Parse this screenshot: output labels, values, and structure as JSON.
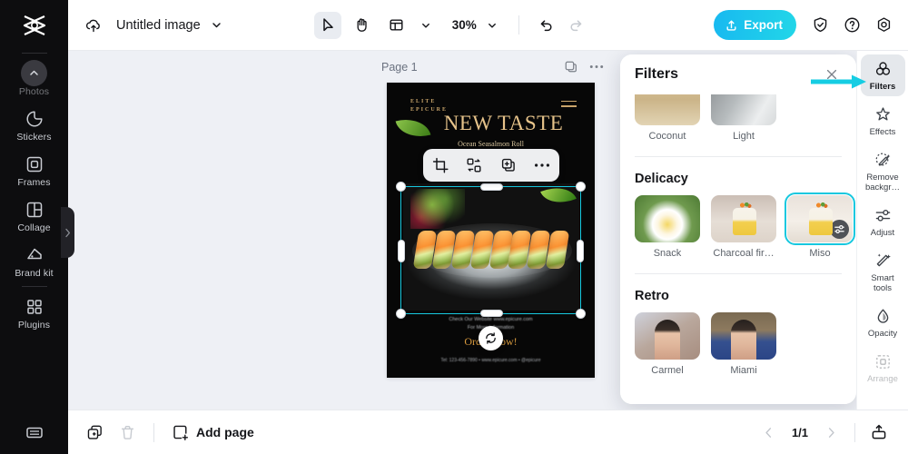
{
  "app": {
    "title": "Untitled image",
    "zoom": "30%",
    "export_label": "Export"
  },
  "topbar": {
    "cloud_icon": "cloud-upload-icon",
    "title_caret_icon": "chevron-down-icon",
    "select_tool_icon": "cursor-arrow-icon",
    "hand_tool_icon": "hand-icon",
    "layout_icon": "layout-icon",
    "layout_caret_icon": "chevron-down-icon",
    "zoom_caret_icon": "chevron-down-icon",
    "undo_icon": "undo-icon",
    "redo_icon": "redo-icon",
    "upload_icon": "upload-icon",
    "shield_icon": "shield-check-icon",
    "help_icon": "question-circle-icon",
    "settings_icon": "settings-gear-icon"
  },
  "left_rail": {
    "logo_icon": "capcut-logo-icon",
    "collapse_icon": "chevron-up-icon",
    "tab_icon": "chevron-right-icon",
    "items": [
      {
        "label": "Photos",
        "icon": "photos-icon"
      },
      {
        "label": "Stickers",
        "icon": "sticker-icon"
      },
      {
        "label": "Frames",
        "icon": "frame-icon"
      },
      {
        "label": "Collage",
        "icon": "collage-icon"
      },
      {
        "label": "Brand kit",
        "icon": "brand-kit-icon"
      },
      {
        "label": "Plugins",
        "icon": "plugins-grid-icon"
      }
    ],
    "bottom_icon": "keyboard-icon"
  },
  "canvas": {
    "page_label": "Page 1",
    "page_icons": [
      "duplicate-page-icon",
      "more-options-icon"
    ],
    "float_toolbar": {
      "crop_icon": "crop-icon",
      "replace_icon": "replace-image-icon",
      "duplicate_icon": "duplicate-icon",
      "more_icon": "more-options-icon"
    },
    "rotate_icon": "rotate-icon",
    "poster": {
      "brand_line1": "ELITE",
      "brand_line2": "EPICURE",
      "title": "NEW TASTE",
      "subtitle": "Ocean Seasalmon Roll",
      "info_line1": "Check Our Website www.epicure.com",
      "info_line2": "For More Information",
      "cta": "Order Now!",
      "footer": "Tel: 123-456-7890 • www.epicure.com • @epicure"
    }
  },
  "filters_panel": {
    "title": "Filters",
    "close_icon": "close-icon",
    "sections": [
      {
        "name": "",
        "items": [
          {
            "label": "Coconut",
            "art": "t-coconut",
            "selected": false
          },
          {
            "label": "Light",
            "art": "t-light",
            "selected": false
          }
        ]
      },
      {
        "name": "Delicacy",
        "items": [
          {
            "label": "Snack",
            "art": "t-snack",
            "selected": false
          },
          {
            "label": "Charcoal fir…",
            "art": "t-charcoal cake",
            "selected": false
          },
          {
            "label": "Miso",
            "art": "t-miso cake",
            "selected": true,
            "badge_icon": "adjust-sliders-icon"
          }
        ]
      },
      {
        "name": "Retro",
        "items": [
          {
            "label": "Carmel",
            "art": "t-carmel portrait",
            "selected": false
          },
          {
            "label": "Miami",
            "art": "t-miami portrait",
            "selected": false
          }
        ]
      }
    ]
  },
  "right_rail": {
    "items": [
      {
        "label": "Filters",
        "icon": "filters-circles-icon",
        "active": true
      },
      {
        "label": "Effects",
        "icon": "effects-sparkle-icon",
        "active": false
      },
      {
        "label": "Remove backgr…",
        "icon": "remove-background-icon",
        "active": false
      },
      {
        "label": "Adjust",
        "icon": "adjust-sliders-icon",
        "active": false
      },
      {
        "label": "Smart tools",
        "icon": "smart-tools-wand-icon",
        "active": false
      },
      {
        "label": "Opacity",
        "icon": "opacity-drop-icon",
        "active": false
      },
      {
        "label": "Arrange",
        "icon": "arrange-icon",
        "active": false
      }
    ]
  },
  "annotation": {
    "arrow_color": "#16cde3",
    "points_to": "Filters"
  },
  "bottombar": {
    "duplicate_icon": "duplicate-page-icon",
    "delete_icon": "trash-icon",
    "add_page_label": "Add page",
    "add_page_icon": "add-page-icon",
    "prev_icon": "chevron-left-icon",
    "page_indicator": "1/1",
    "next_icon": "chevron-right-icon",
    "export_icon": "export-tray-icon"
  },
  "colors": {
    "accent": "#17c8df",
    "export_start": "#18b9f0",
    "export_end": "#22d6e8",
    "canvas_bg": "#eef0f5"
  }
}
